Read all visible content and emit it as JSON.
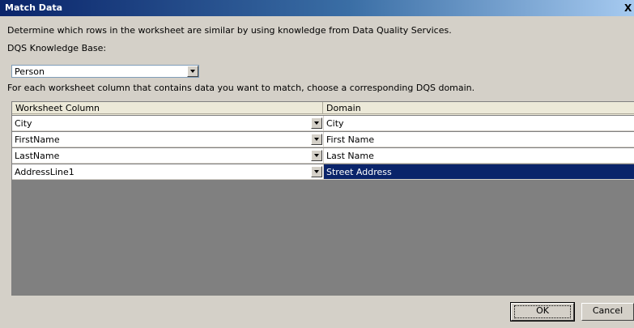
{
  "window": {
    "title": "Match Data",
    "close_label": "X"
  },
  "description": "Determine which rows in the worksheet are similar by using knowledge from Data Quality Services.",
  "knowledge_base": {
    "label": "DQS Knowledge Base:",
    "selected": "Person"
  },
  "columns_description": "For each worksheet column that contains data you want to match, choose a corresponding DQS domain.",
  "grid": {
    "headers": [
      "Worksheet Column",
      "Domain"
    ],
    "rows": [
      {
        "column": "City",
        "domain": "City"
      },
      {
        "column": "FirstName",
        "domain": "First Name"
      },
      {
        "column": "LastName",
        "domain": "Last Name"
      },
      {
        "column": "AddressLine1",
        "domain": "Street Address"
      }
    ]
  },
  "buttons": {
    "ok": "OK",
    "cancel": "Cancel"
  }
}
